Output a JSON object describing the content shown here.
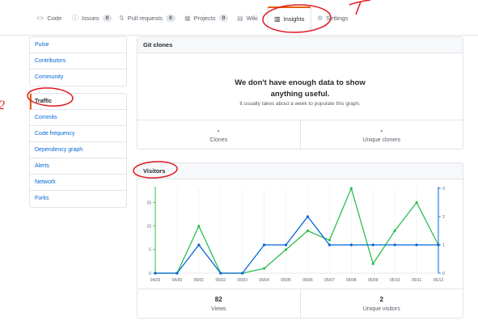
{
  "tabs": [
    {
      "icon": "code-icon",
      "glyph": "<>",
      "label": "Code",
      "count": null
    },
    {
      "icon": "issue-icon",
      "glyph": "ⓘ",
      "label": "Issues",
      "count": "0"
    },
    {
      "icon": "pull-request-icon",
      "glyph": "⇅",
      "label": "Pull requests",
      "count": "0"
    },
    {
      "icon": "project-icon",
      "glyph": "▦",
      "label": "Projects",
      "count": "0"
    },
    {
      "icon": "wiki-icon",
      "glyph": "▤",
      "label": "Wiki",
      "count": null
    },
    {
      "icon": "graph-icon",
      "glyph": "▥",
      "label": "Insights",
      "count": null
    },
    {
      "icon": "gear-icon",
      "glyph": "⚙",
      "label": "Settings",
      "count": null
    }
  ],
  "sidebar": {
    "group1": [
      "Pulse",
      "Contributors",
      "Community"
    ],
    "group2": [
      "Traffic",
      "Commits",
      "Code frequency",
      "Dependency graph",
      "Alerts",
      "Network",
      "Forks"
    ],
    "active": "Traffic"
  },
  "clones": {
    "title": "Git clones",
    "empty_title": "We don't have enough data to show anything useful.",
    "empty_sub": "It usually takes about a week to populate this graph.",
    "stats": [
      {
        "value": "-",
        "label": "Clones"
      },
      {
        "value": "-",
        "label": "Unique cloners"
      }
    ]
  },
  "visitors": {
    "title": "Visitors",
    "stats": [
      {
        "value": "82",
        "label": "Views"
      },
      {
        "value": "2",
        "label": "Unique visitors"
      }
    ]
  },
  "chart_data": {
    "type": "line",
    "x": [
      "04/29",
      "04/30",
      "05/01",
      "05/02",
      "05/03",
      "05/04",
      "05/05",
      "05/06",
      "05/07",
      "05/08",
      "05/09",
      "05/10",
      "05/11",
      "05/12"
    ],
    "y_left_ticks": [
      0,
      5,
      10,
      15
    ],
    "y_right_ticks": [
      0,
      1,
      2,
      3
    ],
    "ylim_left": [
      0,
      18
    ],
    "ylim_right": [
      0,
      3
    ],
    "series": [
      {
        "axis": "left",
        "color": "#2cbe4e",
        "values": [
          0,
          0,
          10,
          0,
          0,
          1,
          5,
          9,
          7,
          18,
          2,
          9,
          15,
          6
        ]
      },
      {
        "axis": "right",
        "color": "#0366d6",
        "values": [
          0,
          0,
          1,
          0,
          0,
          1,
          1,
          2,
          1,
          1,
          1,
          1,
          1,
          1
        ]
      }
    ],
    "grid": "vertical"
  },
  "annotation_labels": [
    "1",
    "2"
  ]
}
